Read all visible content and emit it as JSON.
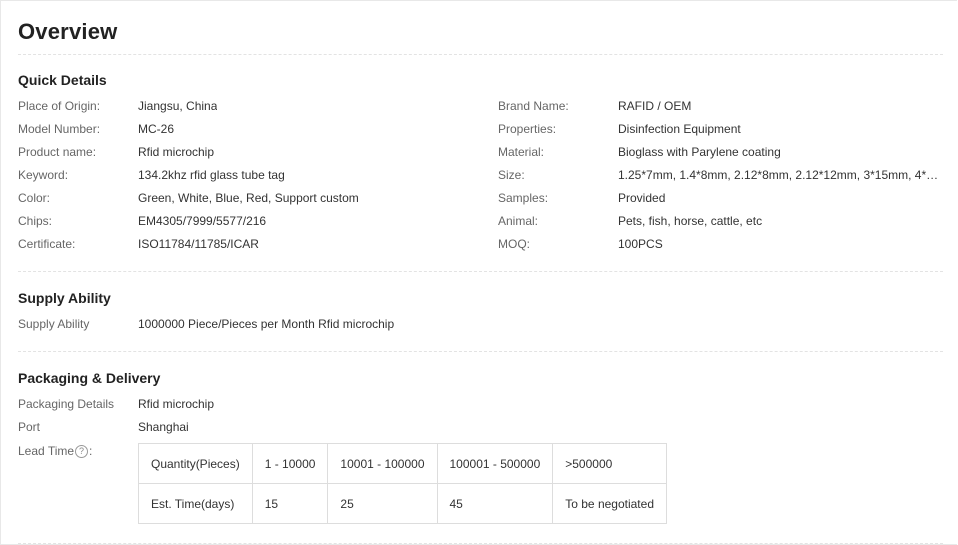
{
  "overview": {
    "title": "Overview"
  },
  "quick_details": {
    "heading": "Quick Details",
    "left": [
      {
        "label": "Place of Origin:",
        "value": "Jiangsu, China"
      },
      {
        "label": "Model Number:",
        "value": "MC-26"
      },
      {
        "label": "Product name:",
        "value": "Rfid microchip"
      },
      {
        "label": "Keyword:",
        "value": "134.2khz rfid glass tube tag"
      },
      {
        "label": "Color:",
        "value": "Green, White, Blue, Red, Support custom"
      },
      {
        "label": "Chips:",
        "value": "EM4305/7999/5577/216"
      },
      {
        "label": "Certificate:",
        "value": "ISO11784/11785/ICAR"
      }
    ],
    "right": [
      {
        "label": "Brand Name:",
        "value": "RAFID / OEM"
      },
      {
        "label": "Properties:",
        "value": "Disinfection Equipment"
      },
      {
        "label": "Material:",
        "value": "Bioglass with Parylene coating"
      },
      {
        "label": "Size:",
        "value": "1.25*7mm, 1.4*8mm, 2.12*8mm, 2.12*12mm, 3*15mm, 4*3…"
      },
      {
        "label": "Samples:",
        "value": "Provided"
      },
      {
        "label": "Animal:",
        "value": "Pets, fish, horse, cattle, etc"
      },
      {
        "label": "MOQ:",
        "value": "100PCS"
      }
    ]
  },
  "supply_ability": {
    "heading": "Supply Ability",
    "label": "Supply Ability",
    "value": "1000000 Piece/Pieces per Month Rfid microchip"
  },
  "packaging": {
    "heading": "Packaging & Delivery",
    "details_label": "Packaging Details",
    "details_value": "Rfid microchip",
    "port_label": "Port",
    "port_value": "Shanghai",
    "lead_time_label": "Lead Time",
    "lead_time_icon": "?",
    "lead_time_suffix": ":",
    "lead_table": {
      "row1": [
        "Quantity(Pieces)",
        "1 - 10000",
        "10001 - 100000",
        "100001 - 500000",
        ">500000"
      ],
      "row2": [
        "Est. Time(days)",
        "15",
        "25",
        "45",
        "To be negotiated"
      ]
    }
  }
}
